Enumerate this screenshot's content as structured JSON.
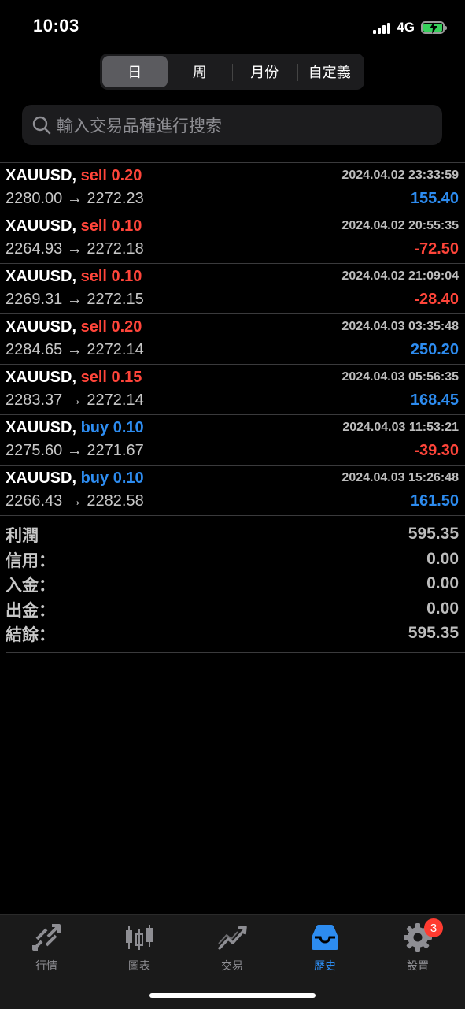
{
  "status_bar": {
    "time": "10:03",
    "network": "4G"
  },
  "period_tabs": [
    {
      "label": "日",
      "active": true
    },
    {
      "label": "周",
      "active": false
    },
    {
      "label": "月份",
      "active": false
    },
    {
      "label": "自定義",
      "active": false
    }
  ],
  "search": {
    "placeholder": "輸入交易品種進行搜索"
  },
  "trades": [
    {
      "symbol": "XAUUSD,",
      "side": "sell",
      "volume": "0.20",
      "prices": "2280.00 → 2272.23",
      "time": "2024.04.02 23:33:59",
      "profit": "155.40"
    },
    {
      "symbol": "XAUUSD,",
      "side": "sell",
      "volume": "0.10",
      "prices": "2264.93 → 2272.18",
      "time": "2024.04.02 20:55:35",
      "profit": "-72.50"
    },
    {
      "symbol": "XAUUSD,",
      "side": "sell",
      "volume": "0.10",
      "prices": "2269.31 → 2272.15",
      "time": "2024.04.02 21:09:04",
      "profit": "-28.40"
    },
    {
      "symbol": "XAUUSD,",
      "side": "sell",
      "volume": "0.20",
      "prices": "2284.65 → 2272.14",
      "time": "2024.04.03 03:35:48",
      "profit": "250.20"
    },
    {
      "symbol": "XAUUSD,",
      "side": "sell",
      "volume": "0.15",
      "prices": "2283.37 → 2272.14",
      "time": "2024.04.03 05:56:35",
      "profit": "168.45"
    },
    {
      "symbol": "XAUUSD,",
      "side": "buy",
      "volume": "0.10",
      "prices": "2275.60 → 2271.67",
      "time": "2024.04.03 11:53:21",
      "profit": "-39.30"
    },
    {
      "symbol": "XAUUSD,",
      "side": "buy",
      "volume": "0.10",
      "prices": "2266.43 → 2282.58",
      "time": "2024.04.03 15:26:48",
      "profit": "161.50"
    }
  ],
  "summary": [
    {
      "label": "利潤",
      "value": "595.35"
    },
    {
      "label": "信用：",
      "value": "0.00"
    },
    {
      "label": "入金：",
      "value": "0.00"
    },
    {
      "label": "出金：",
      "value": "0.00"
    },
    {
      "label": "結餘：",
      "value": "595.35"
    }
  ],
  "tab_bar": [
    {
      "label": "行情",
      "icon": "quotes-icon",
      "active": false
    },
    {
      "label": "圖表",
      "icon": "chart-candles-icon",
      "active": false
    },
    {
      "label": "交易",
      "icon": "trade-icon",
      "active": false
    },
    {
      "label": "歷史",
      "icon": "history-inbox-icon",
      "active": true
    },
    {
      "label": "設置",
      "icon": "gear-icon",
      "active": false,
      "badge": "3"
    }
  ],
  "colors": {
    "accent_blue": "#2d8cf0",
    "sell_red": "#ff453a",
    "background": "#000000"
  }
}
